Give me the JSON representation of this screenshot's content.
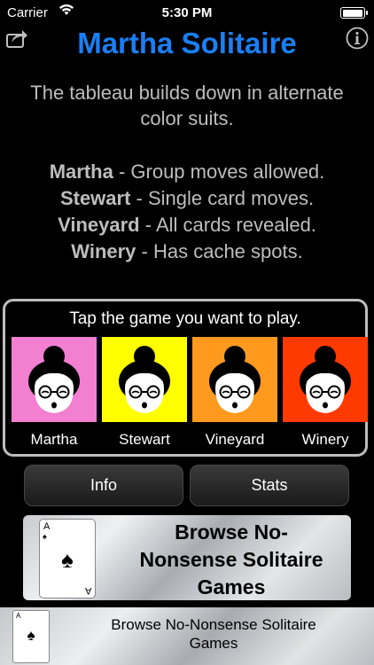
{
  "status": {
    "carrier": "Carrier",
    "time": "5:30 PM",
    "battery_level": 1.0
  },
  "header": {
    "title": "Martha Solitaire"
  },
  "description": "The tableau builds down in alternate color suits.",
  "variants": [
    {
      "name": "Martha",
      "desc": " - Group moves allowed."
    },
    {
      "name": "Stewart",
      "desc": " - Single card moves."
    },
    {
      "name": "Vineyard",
      "desc": " - All cards revealed."
    },
    {
      "name": "Winery",
      "desc": " - Has cache spots."
    }
  ],
  "picker": {
    "prompt": "Tap the game you want to play.",
    "games": [
      {
        "label": "Martha",
        "color": "#f27fd0"
      },
      {
        "label": "Stewart",
        "color": "#ffff00"
      },
      {
        "label": "Vineyard",
        "color": "#ff9a1e"
      },
      {
        "label": "Winery",
        "color": "#ff3a00"
      }
    ]
  },
  "buttons": {
    "info": "Info",
    "stats": "Stats"
  },
  "banner_large": {
    "text_line1": "Browse No-",
    "text_line2": "Nonsense Solitaire",
    "text_line3": "Games",
    "card_rank": "A"
  },
  "banner_small": {
    "text_line1": "Browse No-Nonsense Solitaire",
    "text_line2": "Games",
    "card_rank": "A"
  },
  "icons": {
    "share": "share-icon",
    "info": "info-icon",
    "wifi": "wifi-icon",
    "battery": "battery-icon",
    "spade": "spade-icon",
    "face": "martha-face-icon"
  }
}
